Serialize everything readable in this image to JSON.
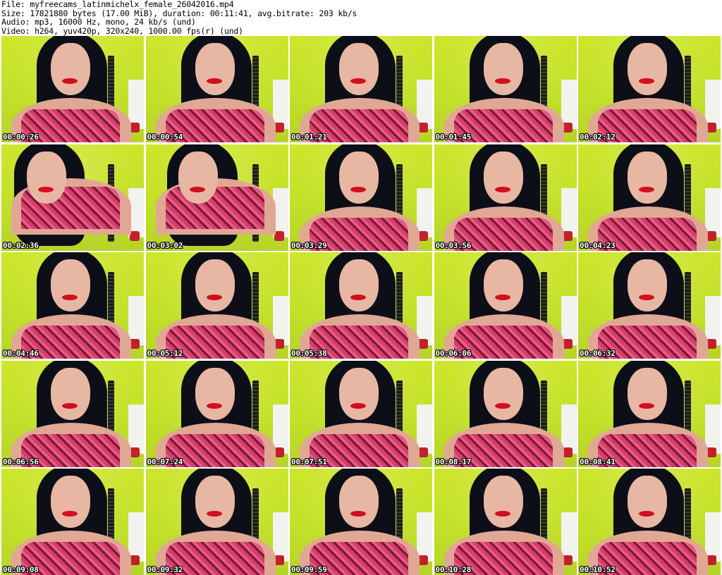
{
  "header": {
    "file": "File: myfreecams_latinmichelx_female_26042016.mp4",
    "size": "Size: 17821880 bytes (17.00 MiB), duration: 00:11:41, avg.bitrate: 203 kb/s",
    "audio": "Audio: mp3, 16000 Hz, mono, 24 kb/s (und)",
    "video": "Video: h264, yuv420p, 320x240, 1000.00 fps(r) (und)"
  },
  "thumbnails": [
    {
      "timestamp": "00:00:26"
    },
    {
      "timestamp": "00:00:54"
    },
    {
      "timestamp": "00:01:21"
    },
    {
      "timestamp": "00:01:45"
    },
    {
      "timestamp": "00:02:12"
    },
    {
      "timestamp": "00:02:36"
    },
    {
      "timestamp": "00:03:02"
    },
    {
      "timestamp": "00:03:29"
    },
    {
      "timestamp": "00:03:56"
    },
    {
      "timestamp": "00:04:23"
    },
    {
      "timestamp": "00:04:46"
    },
    {
      "timestamp": "00:05:12"
    },
    {
      "timestamp": "00:05:38"
    },
    {
      "timestamp": "00:06:06"
    },
    {
      "timestamp": "00:06:32"
    },
    {
      "timestamp": "00:06:56"
    },
    {
      "timestamp": "00:07:24"
    },
    {
      "timestamp": "00:07:51"
    },
    {
      "timestamp": "00:08:17"
    },
    {
      "timestamp": "00:08:41"
    },
    {
      "timestamp": "00:09:08"
    },
    {
      "timestamp": "00:09:32"
    },
    {
      "timestamp": "00:09:59"
    },
    {
      "timestamp": "00:10:28"
    },
    {
      "timestamp": "00:10:52"
    }
  ],
  "colors": {
    "wall": "#c8e22b",
    "hair": "#0d0f18",
    "lips": "#d10f1f",
    "top": "#d53d6a",
    "timestamp_text": "#ffffff"
  }
}
